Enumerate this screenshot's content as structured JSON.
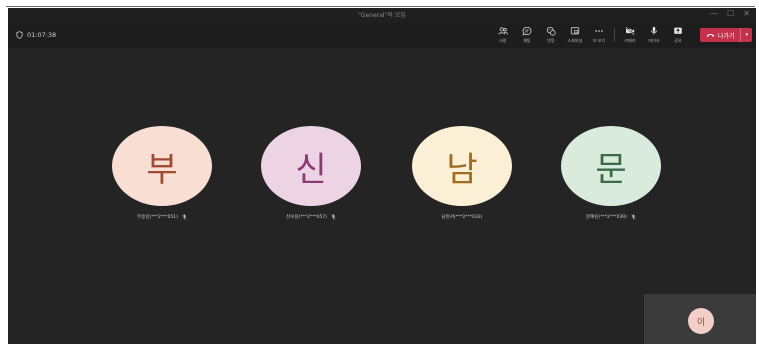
{
  "window": {
    "title": "\"General\"의 모임",
    "controls": {
      "minimize": "—",
      "maximize": "☐",
      "close": "✕"
    }
  },
  "call": {
    "timer": "01:07:38"
  },
  "toolbar": {
    "people": "사람",
    "chat": "채팅",
    "reactions": "반응",
    "rooms": "소회의실",
    "more": "더 보기",
    "camera": "카메라",
    "mic": "마이크",
    "share": "공유",
    "leave": "나가기",
    "leave_dropdown": "▾"
  },
  "participants": [
    {
      "initial": "부",
      "name": "부승민(***2***051)",
      "bg": "#f9ded3",
      "fg": "#a04b33"
    },
    {
      "initial": "신",
      "name": "신보윤(***2***057)",
      "bg": "#ecd4e4",
      "fg": "#8c3a70"
    },
    {
      "initial": "남",
      "name": "남현서(***2***033)",
      "bg": "#fbefd6",
      "fg": "#a06d1e"
    },
    {
      "initial": "문",
      "name": "문예린(***2***039)",
      "bg": "#d8ebdc",
      "fg": "#3d6b47"
    }
  ],
  "self": {
    "initial": "이"
  },
  "colors": {
    "leave": "#c4314b",
    "background": "#242424"
  }
}
